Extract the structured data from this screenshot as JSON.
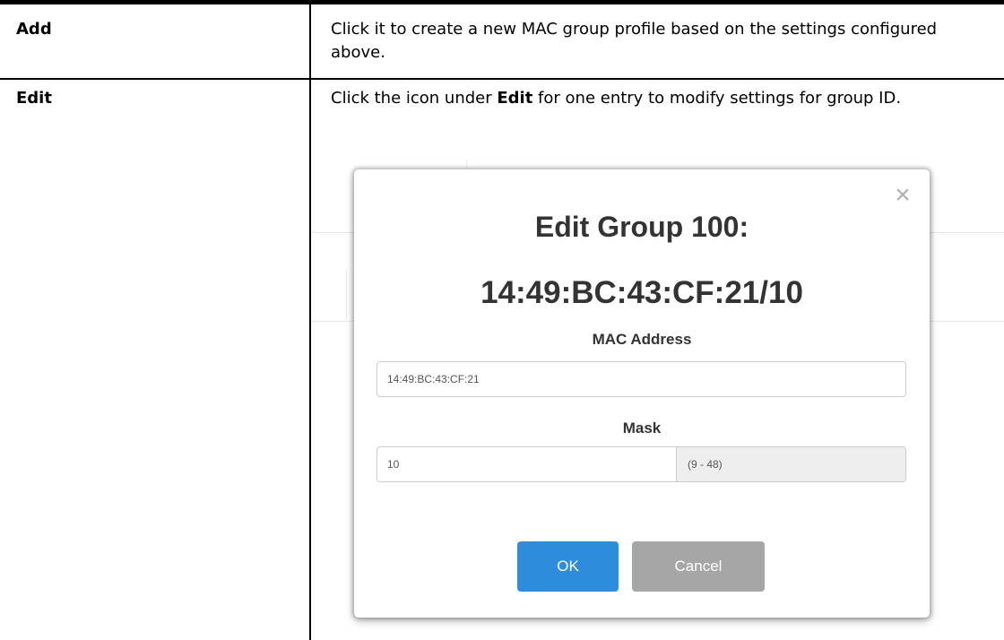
{
  "table": {
    "rows": [
      {
        "term": "Add",
        "description": "Click it to create a new MAC group profile based on the settings configured above."
      },
      {
        "term": "Edit",
        "description_before": "Click the icon under ",
        "description_bold": "Edit",
        "description_after": " for one entry to modify settings for group ID."
      }
    ]
  },
  "dialog": {
    "title": "Edit Group 100:",
    "subtitle": "14:49:BC:43:CF:21/10",
    "close_icon": "close-icon",
    "mac_label": "MAC Address",
    "mac_value": "14:49:BC:43:CF:21",
    "mask_label": "Mask",
    "mask_value": "10",
    "mask_range": "(9 - 48)",
    "ok_label": "OK",
    "cancel_label": "Cancel",
    "colors": {
      "ok": "#2d8cdc",
      "cancel": "#a6a6a6"
    }
  }
}
